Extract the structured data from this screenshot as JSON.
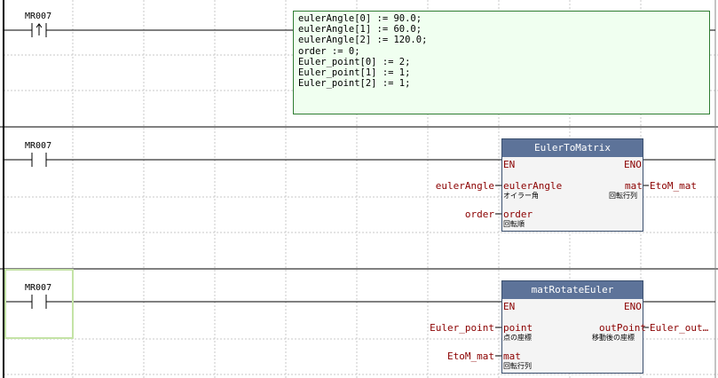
{
  "rungs": [
    {
      "contact": {
        "label": "MR007",
        "type": "rising-edge"
      },
      "st_code": [
        "eulerAngle[0] := 90.0;",
        "eulerAngle[1] := 60.0;",
        "eulerAngle[2] := 120.0;",
        "order := 0;",
        "Euler_point[0] := 2;",
        "Euler_point[1] := 1;",
        "Euler_point[2] := 1;"
      ]
    },
    {
      "contact": {
        "label": "MR007",
        "type": "normally-open"
      },
      "fb": {
        "title": "EulerToMatrix",
        "en": "EN",
        "eno": "ENO",
        "in1": {
          "pin": "eulerAngle",
          "sub": "オイラー角",
          "var": "eulerAngle"
        },
        "in2": {
          "pin": "order",
          "sub": "回転順",
          "var": "order"
        },
        "out1": {
          "pin": "mat",
          "sub": "回転行列",
          "var": "EtoM_mat"
        }
      }
    },
    {
      "contact": {
        "label": "MR007",
        "type": "normally-open"
      },
      "fb": {
        "title": "matRotateEuler",
        "en": "EN",
        "eno": "ENO",
        "in1": {
          "pin": "point",
          "sub": "点の座標",
          "var": "Euler_point"
        },
        "in2": {
          "pin": "mat",
          "sub": "回転行列",
          "var": "EtoM_mat"
        },
        "out1": {
          "pin": "outPoint",
          "sub": "移動後の座標",
          "var": "Euler_out…"
        }
      }
    }
  ],
  "colors": {
    "fb_header": "#5d7399",
    "fb_body": "#f4f4f4",
    "st_box_bg": "#f0fff0",
    "st_box_border": "#2e7d32",
    "pin_text": "#8b0000",
    "selection": "#c4e3a6",
    "grid": "#c8c8c8",
    "wire": "#000000"
  }
}
